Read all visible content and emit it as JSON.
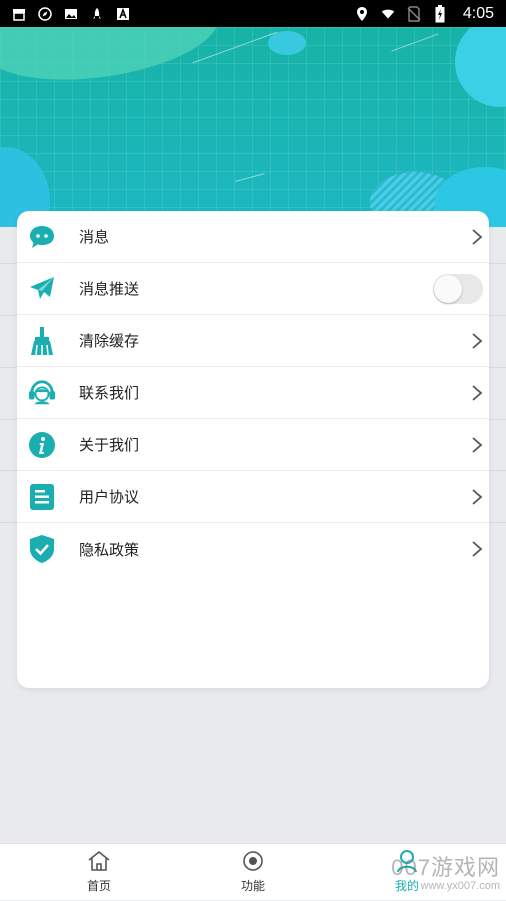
{
  "status_bar": {
    "time": "4:05",
    "left_icons": [
      "store-icon",
      "compass-icon",
      "image-icon",
      "rocket-icon",
      "text-a-icon"
    ],
    "right_icons": [
      "location-icon",
      "wifi-icon",
      "no-sim-icon",
      "battery-charging-icon"
    ]
  },
  "colors": {
    "accent": "#1aaeb0",
    "header_start": "#17b3a6",
    "header_end": "#1cb8c2"
  },
  "menu": {
    "items": [
      {
        "label": "消息",
        "icon": "chat-bubble-icon",
        "control": "chevron"
      },
      {
        "label": "消息推送",
        "icon": "paper-plane-icon",
        "control": "toggle",
        "toggle_on": false
      },
      {
        "label": "清除缓存",
        "icon": "broom-icon",
        "control": "chevron"
      },
      {
        "label": "联系我们",
        "icon": "headset-icon",
        "control": "chevron"
      },
      {
        "label": "关于我们",
        "icon": "info-icon",
        "control": "chevron"
      },
      {
        "label": "用户协议",
        "icon": "document-icon",
        "control": "chevron"
      },
      {
        "label": "隐私政策",
        "icon": "shield-check-icon",
        "control": "chevron"
      }
    ]
  },
  "tabs": [
    {
      "label": "首页",
      "icon": "home-icon"
    },
    {
      "label": "功能",
      "icon": "target-icon"
    },
    {
      "label": "我的",
      "icon": "user-icon"
    }
  ],
  "watermark": {
    "text": "007游戏网",
    "url": "www.yx007.com"
  }
}
